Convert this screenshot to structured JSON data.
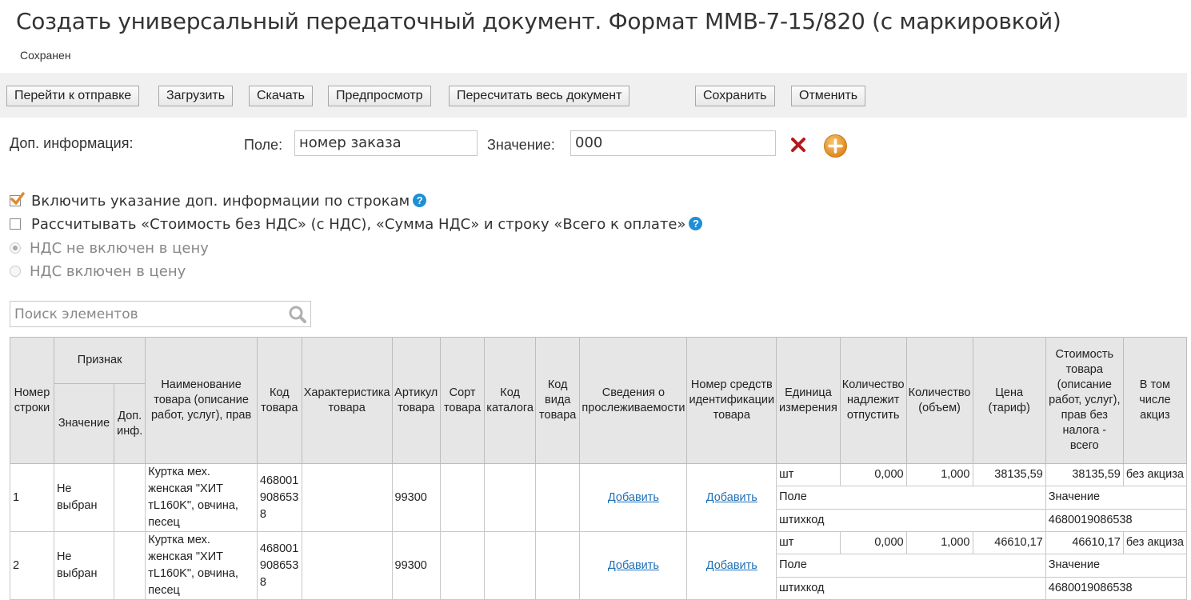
{
  "page": {
    "title": "Создать универсальный передаточный документ. Формат ММВ-7-15/820 (с маркировкой)",
    "status": "Сохранен"
  },
  "toolbar": {
    "goto_send": "Перейти к отправке",
    "upload": "Загрузить",
    "download": "Скачать",
    "preview": "Предпросмотр",
    "recalc": "Пересчитать весь документ",
    "save": "Сохранить",
    "cancel": "Отменить"
  },
  "extra_info": {
    "label": "Доп. информация:",
    "field_label": "Поле:",
    "field_value": "номер заказа",
    "value_label": "Значение:",
    "value_value": "000"
  },
  "options": {
    "include_extra_by_rows": "Включить указание доп. информации по строкам",
    "include_extra_by_rows_checked": true,
    "calc_totals": "Рассчитывать «Стоимость без НДС» (с НДС), «Сумма НДС» и строку «Всего к оплате»",
    "calc_totals_checked": false,
    "vat_not_included": "НДС не включен в цену",
    "vat_included": "НДС включен в цену",
    "vat_selected": "not_included",
    "help_glyph": "?"
  },
  "search": {
    "placeholder": "Поиск элементов"
  },
  "table": {
    "headers": {
      "row_num": "Номер строки",
      "sign": "Признак",
      "sign_value": "Значение",
      "sign_extra": "Доп. инф.",
      "name": "Наименование товара (описание работ, услуг), прав",
      "code": "Код товара",
      "charact": "Характеристика товара",
      "article": "Артикул товара",
      "sort": "Сорт товара",
      "catalog": "Код каталога",
      "kind": "Код вида товара",
      "trace": "Сведения о прослеживаемости",
      "ident": "Номер средств идентификации товара",
      "unit": "Единица измерения",
      "qty_release": "Количество надлежит отпустить",
      "qty": "Количество (объем)",
      "price": "Цена (тариф)",
      "cost_no_tax": "Стоимость товара (описание работ, услуг), прав без налога - всего",
      "excise": "В том числе акциз"
    },
    "rows": [
      {
        "num": "1",
        "sign_value": "Не выбран",
        "sign_extra": "",
        "name": "Куртка мех. женская \"ХИТ тL160K\", овчина, песец",
        "code": "4680019086538",
        "charact": "",
        "article": "99300",
        "sort": "",
        "catalog": "",
        "kind": "",
        "trace": "Добавить",
        "ident": "Добавить",
        "unit": "шт",
        "qty_release": "0,000",
        "qty": "1,000",
        "price": "38135,59",
        "cost": "38135,59",
        "excise": "без акциза",
        "extra_field_header": "Поле",
        "extra_value_header": "Значение",
        "extra_field": "штихкод",
        "extra_value": "4680019086538"
      },
      {
        "num": "2",
        "sign_value": "Не выбран",
        "sign_extra": "",
        "name": "Куртка мех. женская \"ХИТ тL160K\", овчина, песец",
        "code": "4680019086538",
        "charact": "",
        "article": "99300",
        "sort": "",
        "catalog": "",
        "kind": "",
        "trace": "Добавить",
        "ident": "Добавить",
        "unit": "шт",
        "qty_release": "0,000",
        "qty": "1,000",
        "price": "46610,17",
        "cost": "46610,17",
        "excise": "без акциза",
        "extra_field_header": "Поле",
        "extra_value_header": "Значение",
        "extra_field": "штихкод",
        "extra_value": "4680019086538"
      }
    ]
  },
  "colors": {
    "accent_link": "#1f6fb6",
    "delete_icon": "#b3191c",
    "add_icon": "#f0a033",
    "help_icon": "#1d8fd6",
    "checkbox_check": "#e08a2e"
  },
  "icons": [
    "delete-icon",
    "add-icon",
    "help-icon",
    "search-icon",
    "checkmark-icon"
  ]
}
